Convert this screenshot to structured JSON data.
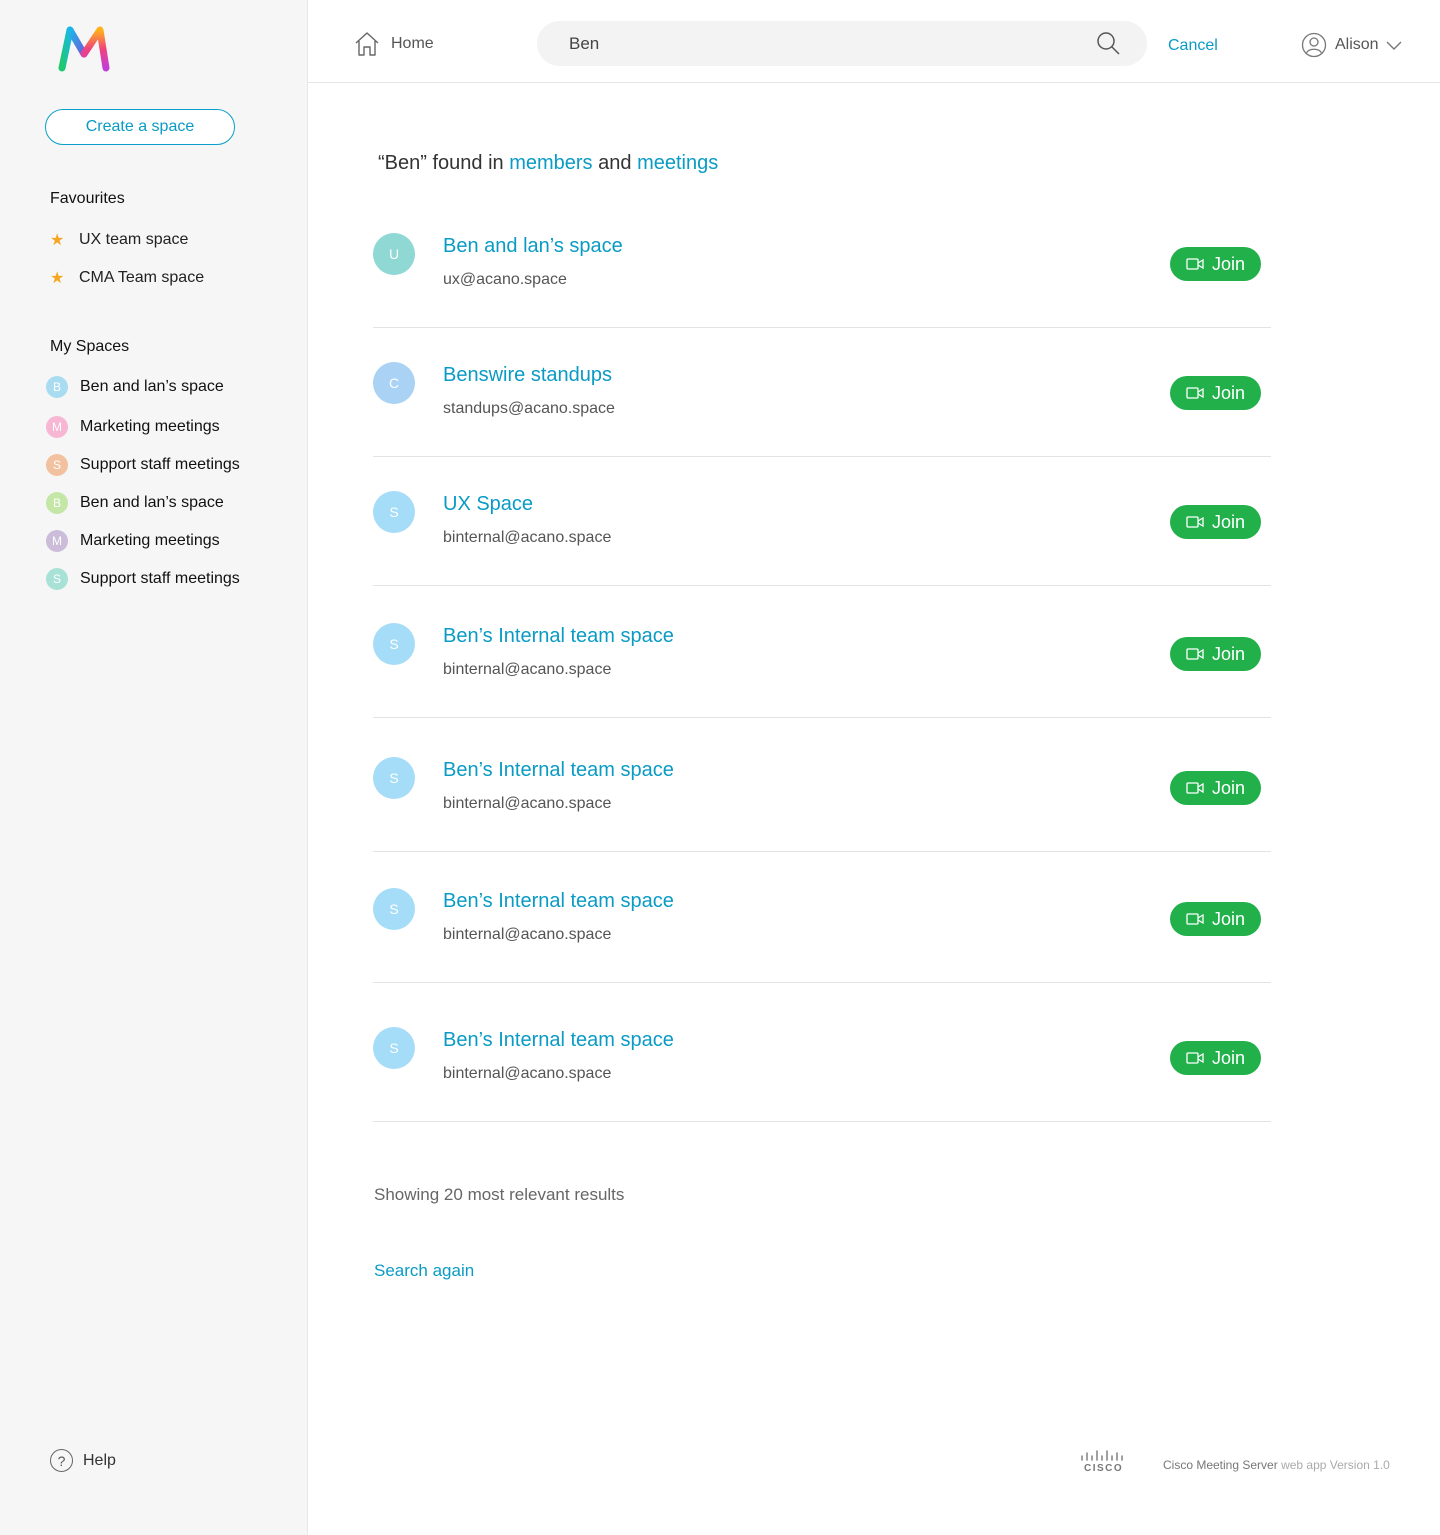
{
  "sidebar": {
    "create_label": "Create a space",
    "favourites_title": "Favourites",
    "favourites": [
      {
        "label": "UX team space"
      },
      {
        "label": "CMA Team space"
      }
    ],
    "myspaces_title": "My Spaces",
    "spaces": [
      {
        "initial": "B",
        "label": "Ben and lan’s space",
        "color": "#a9dcf0"
      },
      {
        "initial": "M",
        "label": "Marketing meetings",
        "color": "#f7b6d4"
      },
      {
        "initial": "S",
        "label": "Support staff meetings",
        "color": "#f2c1a0"
      },
      {
        "initial": "B",
        "label": "Ben and lan’s space",
        "color": "#c4e6a6"
      },
      {
        "initial": "M",
        "label": "Marketing meetings",
        "color": "#cbbcd9"
      },
      {
        "initial": "S",
        "label": "Support staff meetings",
        "color": "#a8e2d6"
      }
    ],
    "help_label": "Help"
  },
  "topbar": {
    "home_label": "Home",
    "search_value": "Ben",
    "cancel_label": "Cancel",
    "user_name": "Alison"
  },
  "results": {
    "heading_prefix": "“Ben” found in",
    "heading_link1": "members",
    "heading_and": "and",
    "heading_link2": "meetings",
    "join_label": "Join",
    "items": [
      {
        "initial": "U",
        "title": "Ben and lan’s space",
        "email": "ux@acano.space",
        "color": "#8fd8d4"
      },
      {
        "initial": "C",
        "title": "Benswire standups",
        "email": "standups@acano.space",
        "color": "#a9d2f5"
      },
      {
        "initial": "S",
        "title": "UX Space",
        "email": "binternal@acano.space",
        "color": "#a5dcf7"
      },
      {
        "initial": "S",
        "title": "Ben’s Internal team space",
        "email": "binternal@acano.space",
        "color": "#a5dcf7"
      },
      {
        "initial": "S",
        "title": "Ben’s Internal team space",
        "email": "binternal@acano.space",
        "color": "#a5dcf7"
      },
      {
        "initial": "S",
        "title": "Ben’s Internal team space",
        "email": "binternal@acano.space",
        "color": "#a5dcf7"
      },
      {
        "initial": "S",
        "title": "Ben’s Internal team space",
        "email": "binternal@acano.space",
        "color": "#a5dcf7"
      }
    ],
    "showing_text": "Showing 20 most relevant results",
    "search_again_label": "Search again"
  },
  "footer": {
    "cisco_word": "CISCO",
    "product": "Cisco Meeting Server",
    "webapp": "web app",
    "version": "Version 1.0"
  },
  "colors": {
    "accent": "#0a9bc4",
    "join_green": "#22b04b",
    "star": "#f5a623"
  }
}
